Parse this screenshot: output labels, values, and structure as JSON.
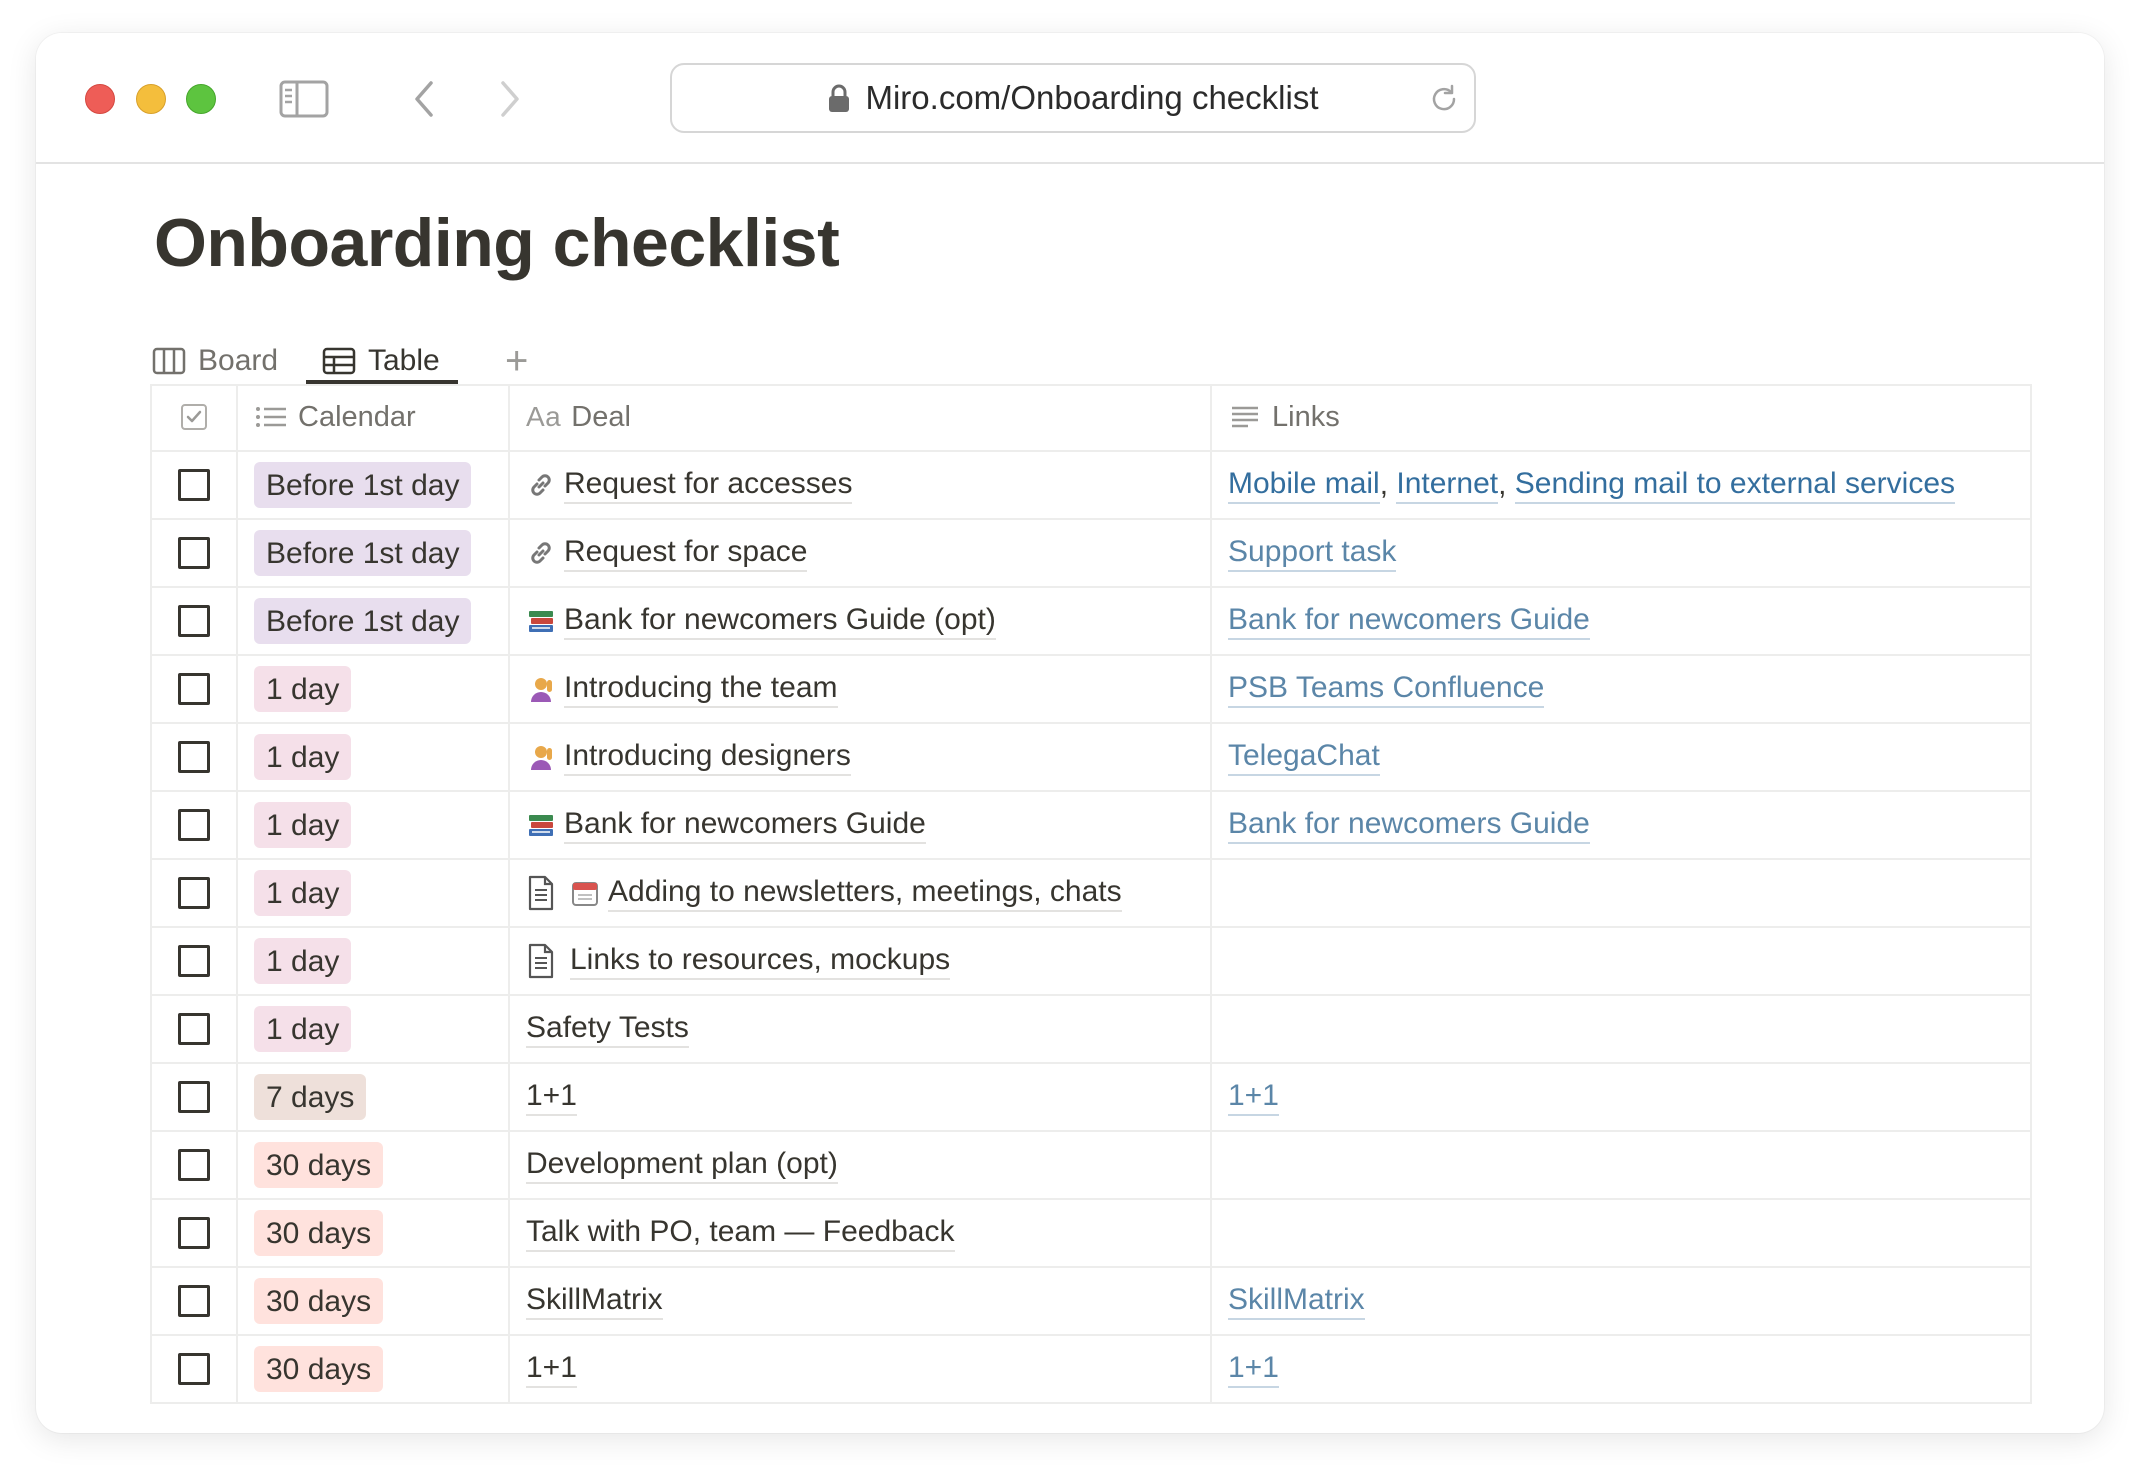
{
  "browser": {
    "url": "Miro.com/Onboarding checklist",
    "traffic_colors": [
      "#ee5d57",
      "#f4be3c",
      "#5dc43f"
    ]
  },
  "page": {
    "title": "Onboarding checklist"
  },
  "views": {
    "tabs": [
      {
        "label": "Board",
        "icon": "board-icon",
        "active": false
      },
      {
        "label": "Table",
        "icon": "table-icon",
        "active": true
      }
    ],
    "add_label": "+"
  },
  "table": {
    "headers": {
      "calendar": "Calendar",
      "deal_prefix": "Aa",
      "deal": "Deal",
      "links": "Links"
    },
    "tag_colors": {
      "before": "#e8deee",
      "day": "#f5e0e9",
      "week": "#eee0da",
      "month": "#ffe2dd"
    },
    "link_color": "#5b86a8",
    "rows": [
      {
        "calendar": "Before 1st day",
        "deal": "Request for accesses",
        "links": [
          "Mobile mail",
          "Internet",
          "Sending mail to external services"
        ]
      },
      {
        "calendar": "Before 1st day",
        "deal": "Request for space",
        "links": [
          "Support task"
        ]
      },
      {
        "calendar": "Before 1st day",
        "deal": "Bank for newcomers Guide (opt)",
        "links": [
          "Bank for newcomers Guide"
        ]
      },
      {
        "calendar": "1 day",
        "deal": "Introducing the team",
        "links": [
          "PSB Teams Confluence"
        ]
      },
      {
        "calendar": "1 day",
        "deal": "Introducing designers",
        "links": [
          "TelegaChat"
        ]
      },
      {
        "calendar": "1 day",
        "deal": "Bank for newcomers Guide",
        "links": [
          "Bank for newcomers Guide"
        ]
      },
      {
        "calendar": "1 day",
        "deal": "Adding to newsletters, meetings, chats",
        "links": []
      },
      {
        "calendar": "1 day",
        "deal": "Links to resources, mockups",
        "links": []
      },
      {
        "calendar": "1 day",
        "deal": "Safety Tests",
        "links": []
      },
      {
        "calendar": "7 days",
        "deal": "1+1",
        "links": [
          "1+1"
        ]
      },
      {
        "calendar": "30 days",
        "deal": "Development plan (opt)",
        "links": []
      },
      {
        "calendar": "30 days",
        "deal": "Talk with PO, team — Feedback",
        "links": []
      },
      {
        "calendar": "30 days",
        "deal": "SkillMatrix",
        "links": [
          "SkillMatrix"
        ]
      },
      {
        "calendar": "30 days",
        "deal": "1+1",
        "links": [
          "1+1"
        ]
      }
    ]
  }
}
